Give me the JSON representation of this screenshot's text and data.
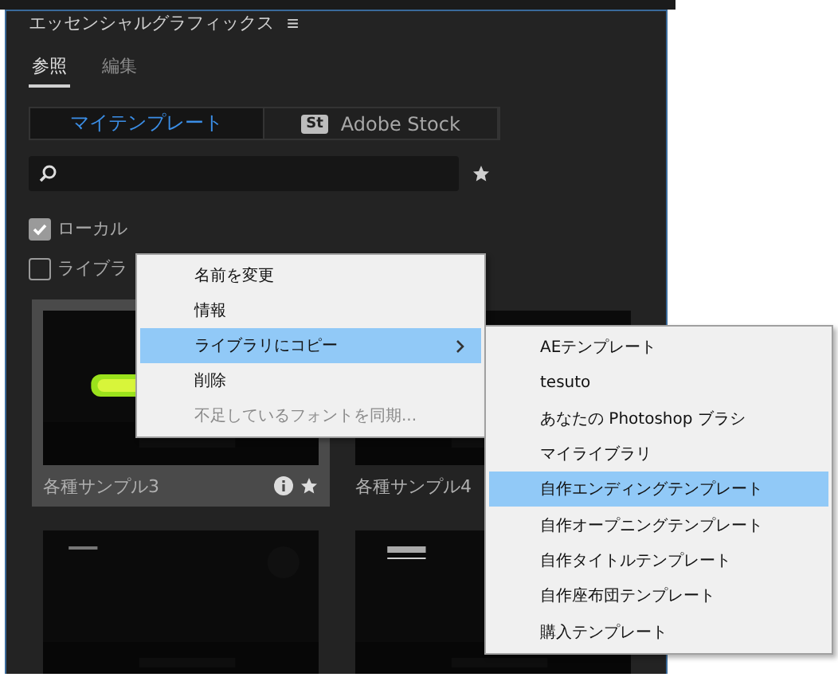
{
  "panel": {
    "title": "エッセンシャルグラフィックス",
    "menu_icon": "≡"
  },
  "tabs": [
    {
      "label": "参照",
      "selected": true
    },
    {
      "label": "編集",
      "selected": false
    }
  ],
  "sources": [
    {
      "label": "マイテンプレート",
      "selected": true,
      "kind": "text"
    },
    {
      "label": "Adobe Stock",
      "selected": false,
      "kind": "stock",
      "badge": "St"
    }
  ],
  "filters": [
    {
      "label": "ローカル",
      "checked": true
    },
    {
      "label": "ライブラ",
      "checked": false
    }
  ],
  "templates": [
    {
      "name": "各種サンプル3",
      "selected": true,
      "info": true,
      "favorite": true,
      "kind": "picture"
    },
    {
      "name": "各種サンプル4",
      "selected": false,
      "info": false,
      "favorite": false,
      "kind": "picture"
    },
    {
      "kind": "picture",
      "selected": false
    },
    {
      "kind": "picture",
      "selected": false
    }
  ],
  "context_menu": {
    "items": [
      {
        "label": "名前を変更",
        "selected": false,
        "disabled": false,
        "submenu": false
      },
      {
        "label": "情報",
        "selected": false,
        "disabled": false,
        "submenu": false
      },
      {
        "label": "ライブラリにコピー",
        "selected": true,
        "disabled": false,
        "submenu": true
      },
      {
        "label": "削除",
        "selected": false,
        "disabled": false,
        "submenu": false
      },
      {
        "label": "不足しているフォントを同期...",
        "selected": false,
        "disabled": true,
        "submenu": false
      }
    ]
  },
  "submenu": {
    "items": [
      {
        "label": "AEテンプレート",
        "selected": false
      },
      {
        "label": "tesuto",
        "selected": false
      },
      {
        "label": "あなたの Photoshop ブラシ",
        "selected": false
      },
      {
        "label": "マイライブラリ",
        "selected": false
      },
      {
        "label": "自作エンディングテンプレート",
        "selected": true
      },
      {
        "label": "自作オープニングテンプレート",
        "selected": false
      },
      {
        "label": "自作タイトルテンプレート",
        "selected": false
      },
      {
        "label": "自作座布団テンプレート",
        "selected": false
      },
      {
        "label": "購入テンプレート",
        "selected": false
      }
    ]
  }
}
